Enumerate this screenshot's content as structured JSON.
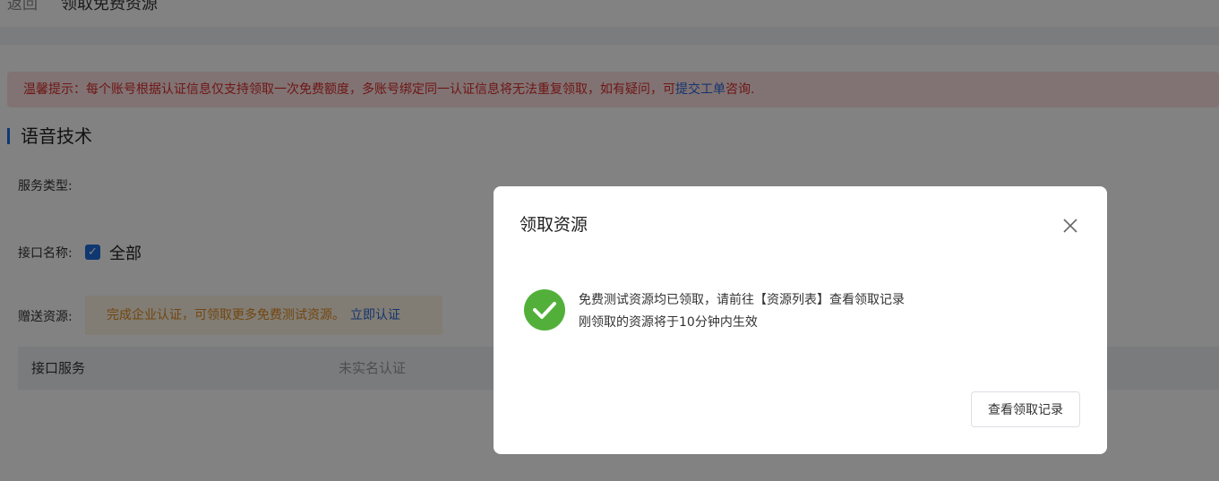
{
  "header": {
    "back_label": "返回",
    "title": "领取免费资源"
  },
  "notice": {
    "text_prefix": "温馨提示：每个账号根据认证信息仅支持领取一次免费额度，多账号绑定同一认证信息将无法重复领取，如有疑问，可",
    "link_text": "提交工单",
    "text_suffix": "咨询."
  },
  "section": {
    "title": "语音技术",
    "service_type_label": "服务类型:",
    "interface_name_label": "接口名称:",
    "interface_all_label": "全部",
    "interface_all_checked": true,
    "gift_label": "赠送资源:",
    "gift_notice": "完成企业认证，可领取更多免费测试资源。",
    "gift_link": "立即认证"
  },
  "table": {
    "columns": [
      "接口服务",
      "未实名认证"
    ]
  },
  "modal": {
    "title": "领取资源",
    "message_line1": "免费测试资源均已领取，请前往【资源列表】查看领取记录",
    "message_line2": "刚领取的资源将于10分钟内生效",
    "button_label": "查看领取记录",
    "status_icon": "success-check-icon"
  },
  "colors": {
    "accent": "#1f6fdb",
    "success": "#52b03a",
    "warning_text": "#d92c2c",
    "gift_text": "#e08a1e"
  }
}
